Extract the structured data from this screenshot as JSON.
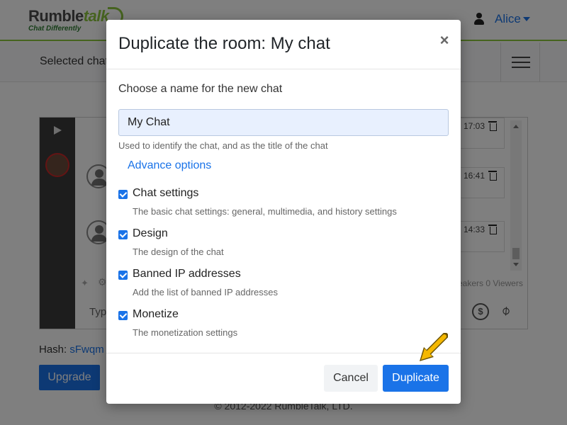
{
  "app": {
    "logo_name": "Rumble",
    "logo_name_accent": "talk",
    "logo_tagline": "Chat Differently",
    "user_name": "Alice"
  },
  "subbar": {
    "label": "Selected chat"
  },
  "chat_preview": {
    "messages": [
      {
        "time": "17:03"
      },
      {
        "time": "16:41"
      },
      {
        "time": "14:33"
      }
    ],
    "stats_text": "eakers 0 Viewers",
    "input_placeholder": "Type"
  },
  "page": {
    "hash_label": "Hash: ",
    "hash_value": "sFwqm",
    "upgrade_label": "Upgrade",
    "footer_text": "© 2012-2022 RumbleTalk, LTD."
  },
  "modal": {
    "title": "Duplicate the room: My chat",
    "close_symbol": "×",
    "name_label": "Choose a name for the new chat",
    "name_value": "My Chat",
    "name_help": "Used to identify the chat, and as the title of the chat",
    "advance_link": "Advance options",
    "options": [
      {
        "label": "Chat settings",
        "description": "The basic chat settings: general, multimedia, and history settings",
        "checked": true
      },
      {
        "label": "Design",
        "description": "The design of the chat",
        "checked": true
      },
      {
        "label": "Banned IP addresses",
        "description": "Add the list of banned IP addresses",
        "checked": true
      },
      {
        "label": "Monetize",
        "description": "The monetization settings",
        "checked": true
      }
    ],
    "cancel_label": "Cancel",
    "duplicate_label": "Duplicate"
  },
  "colors": {
    "accent": "#1a73e8",
    "brand_green": "#8cc63f",
    "pointer_arrow": "#f5b800"
  }
}
